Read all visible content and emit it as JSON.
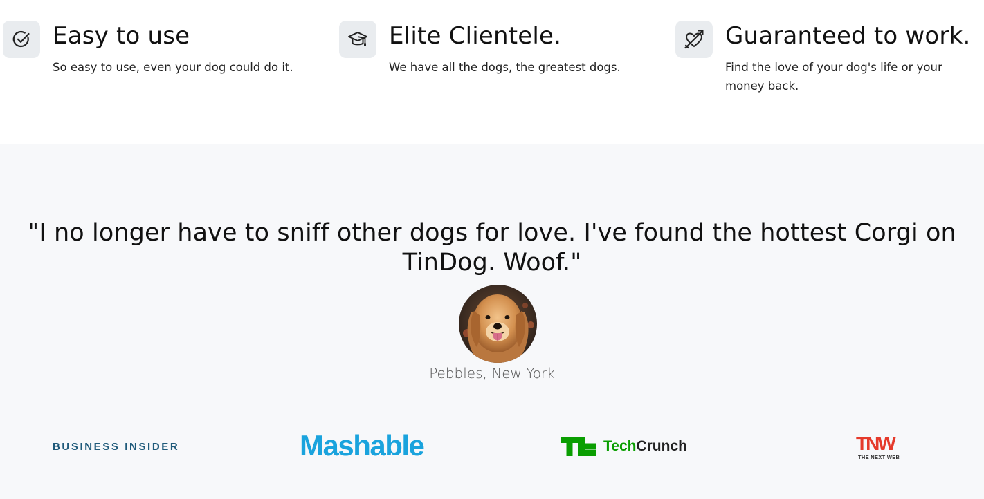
{
  "features": [
    {
      "icon": "check-circle-icon",
      "title": "Easy to use",
      "description": "So easy to use, even your dog could do it."
    },
    {
      "icon": "graduation-cap-icon",
      "title": "Elite Clientele.",
      "description": "We have all the dogs, the greatest dogs."
    },
    {
      "icon": "heart-arrow-icon",
      "title": "Guaranteed to work.",
      "description": "Find the love of your dog's life or your money back."
    }
  ],
  "testimonial": {
    "quote": "\"I no longer have to sniff other dogs for love. I've found the hottest Corgi on TinDog. Woof.\"",
    "author": "Pebbles, New York",
    "avatar": "golden-retriever-photo"
  },
  "press": {
    "business_insider": "BUSINESS INSIDER",
    "mashable": "Mashable",
    "techcrunch_tech": "Tech",
    "techcrunch_crunch": "Crunch",
    "tnw_mark": "TNW",
    "tnw_sub": "THE NEXT WEB"
  },
  "colors": {
    "section_bg": "#f7f8fa",
    "icon_bg": "#e9ecef",
    "mashable": "#1aa3dd",
    "techcrunch": "#0a9e01",
    "business_insider": "#1f5a7a",
    "tnw": "#e53a2b"
  }
}
